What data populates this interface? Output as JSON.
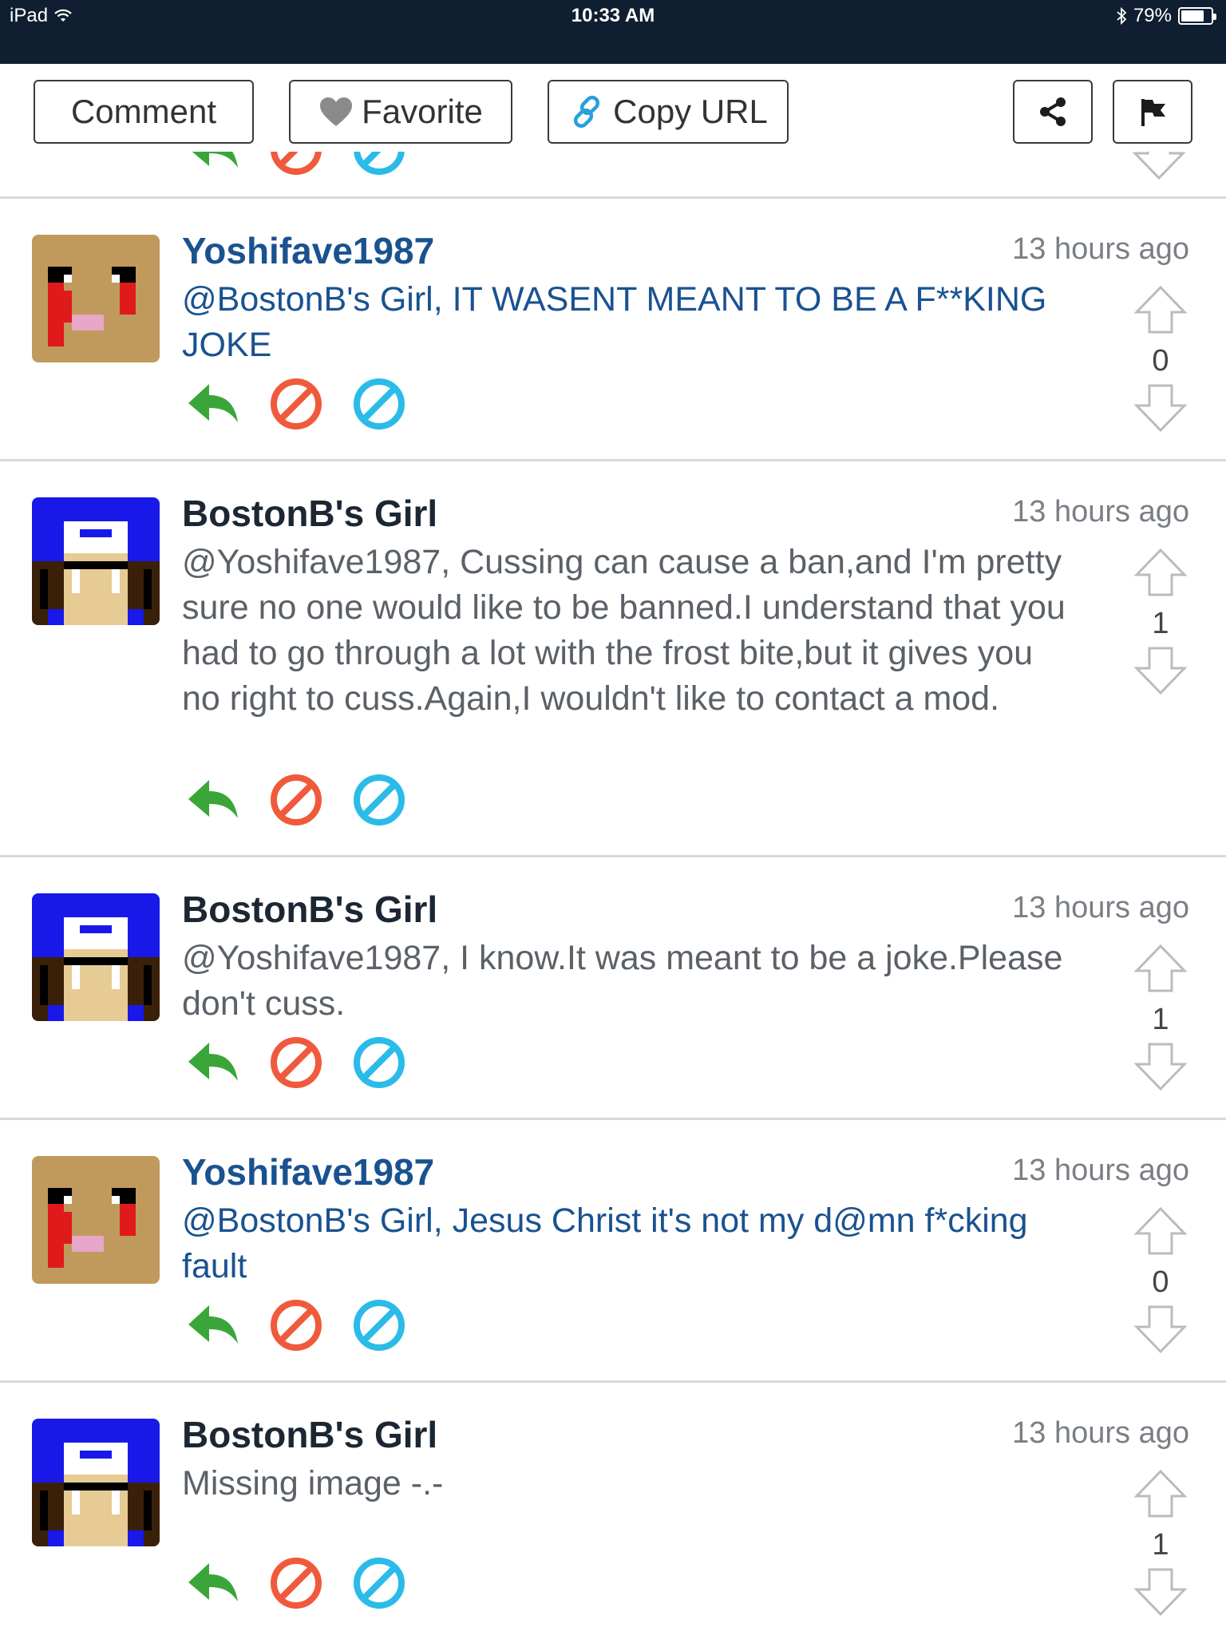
{
  "status_bar": {
    "device": "iPad",
    "time": "10:33 AM",
    "battery": "79%",
    "battery_level": 0.79,
    "icons": [
      "wifi-icon",
      "bluetooth-icon",
      "battery-icon"
    ]
  },
  "toolbar": {
    "comment_label": "Comment",
    "favorite_label": "Favorite",
    "copy_url_label": "Copy URL",
    "icons": [
      "heart-icon",
      "link-icon",
      "share-icon",
      "flag-icon"
    ]
  },
  "colors": {
    "status_bar_bg": "#0f1f31",
    "reply_green": "#3aa63a",
    "block_red": "#f05a3c",
    "ignore_blue": "#2bbbe8",
    "username_blue": "#1a5290",
    "vote_gray": "#b8bcc0"
  },
  "comments": [
    {
      "author": "Yoshifave1987",
      "time": "13 hours ago",
      "text": "@BostonB's Girl, IT WASENT MEANT TO BE A F**KING JOKE",
      "votes": "0",
      "avatar": "yoshifave-avatar"
    },
    {
      "author": "BostonB's Girl",
      "time": "13 hours ago",
      "text": "@Yoshifave1987, Cussing can cause a ban,and I'm pretty sure no one would like to be banned.I understand that you had to go through a lot with the frost bite,but it gives you no right to cuss.Again,I wouldn't like to contact a mod.",
      "votes": "1",
      "avatar": "bostonb-girl-avatar"
    },
    {
      "author": "BostonB's Girl",
      "time": "13 hours ago",
      "text": "@Yoshifave1987, I know.It was meant to be a joke.Please don't cuss.",
      "votes": "1",
      "avatar": "bostonb-girl-avatar"
    },
    {
      "author": "Yoshifave1987",
      "time": "13 hours ago",
      "text": "@BostonB's Girl, Jesus Christ it's not my d@mn f*cking fault",
      "votes": "0",
      "avatar": "yoshifave-avatar"
    },
    {
      "author": "BostonB's Girl",
      "time": "13 hours ago",
      "text": "Missing image -.-",
      "votes": "1",
      "avatar": "bostonb-girl-avatar"
    }
  ]
}
